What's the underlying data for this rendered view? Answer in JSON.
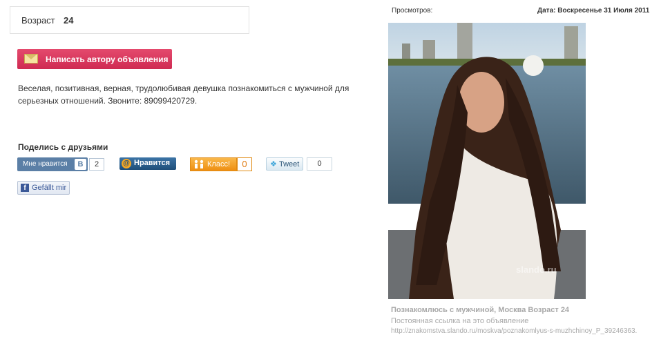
{
  "age": {
    "label": "Возраст",
    "value": "24"
  },
  "write_button": {
    "label": "Написать автору объявления",
    "icon": "envelope-icon"
  },
  "description": "Веселая, позитивная, верная, трудолюбивая девушка познакомиться с мужчиной для серьезных отношений. Звоните: 89099420729.",
  "share": {
    "title": "Поделись с друзьями",
    "vk": {
      "label": "Мне нравится",
      "logo": "В",
      "count": "2"
    },
    "mailru": {
      "label": "Нравится",
      "logo": "@"
    },
    "ok": {
      "label": "Класс!",
      "count": "0"
    },
    "twitter": {
      "label": "Tweet",
      "count": "0"
    },
    "facebook": {
      "label": "Gefällt mir",
      "logo": "f"
    }
  },
  "meta": {
    "views_label": "Просмотров:",
    "date_label": "Дата:",
    "date_value": "Воскресенье 31 Июля 2011"
  },
  "photo": {
    "watermark": "slando.ru"
  },
  "caption": {
    "title": "Познакомлюсь с мужчиной, Москва Возраст 24",
    "permalink_label": "Постоянная ссылка на это объявление",
    "permalink_url": "http://znakomstva.slando.ru/moskva/poznakomlyus-s-muzhchinoy_P_39246363."
  },
  "colors": {
    "accent": "#d9385e",
    "vk": "#5b7fa6",
    "ok": "#f6a623",
    "fb": "#3b5998"
  }
}
